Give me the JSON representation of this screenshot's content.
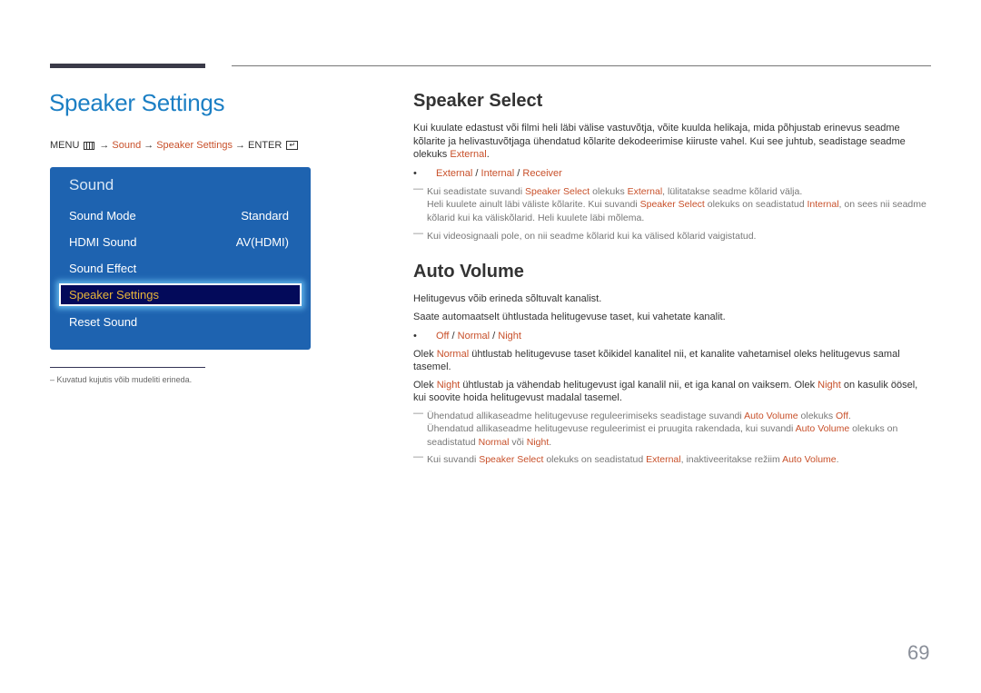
{
  "page_title": "Speaker Settings",
  "breadcrumb": {
    "menu": "MENU",
    "menu_icon": "menu-grid-icon",
    "arrow": "→",
    "sound": "Sound",
    "speaker_settings": "Speaker Settings",
    "enter": "ENTER",
    "enter_icon": "enter-icon"
  },
  "osd_menu": {
    "title": "Sound",
    "items": [
      {
        "label": "Sound Mode",
        "value": "Standard"
      },
      {
        "label": "HDMI Sound",
        "value": "AV(HDMI)"
      },
      {
        "label": "Sound Effect",
        "value": ""
      },
      {
        "label": "Speaker Settings",
        "value": "",
        "selected": true
      },
      {
        "label": "Reset Sound",
        "value": ""
      }
    ]
  },
  "left_note": "–  Kuvatud kujutis võib mudeliti erineda.",
  "speaker_select": {
    "heading": "Speaker Select",
    "intro": "Kui kuulate edastust või filmi heli läbi välise vastuvõtja, võite kuulda helikaja, mida põhjustab erinevus seadme kõlarite ja helivastuvõtjaga ühendatud kõlarite dekodeerimise kiiruste vahel. Kui see juhtub, seadistage seadme olekuks ",
    "intro_hl": "External",
    "intro_end": ".",
    "options": [
      "External",
      "Internal",
      "Receiver"
    ],
    "option_sep": " / ",
    "note1": {
      "a": "Kui seadistate suvandi ",
      "b": "Speaker Select",
      "c": " olekuks ",
      "d": "External",
      "e": ", lülitatakse seadme kõlarid välja.",
      "f": "Heli kuulete ainult läbi väliste kõlarite. Kui suvandi ",
      "g": "Speaker Select",
      "h": " olekuks on seadistatud ",
      "i": "Internal",
      "j": ", on sees nii seadme kõlarid kui ka väliskõlarid. Heli kuulete läbi mõlema."
    },
    "note2": "Kui videosignaali pole, on nii seadme kõlarid kui ka välised kõlarid vaigistatud."
  },
  "auto_volume": {
    "heading": "Auto Volume",
    "p1": "Helitugevus võib erineda sõltuvalt kanalist.",
    "p2": "Saate automaatselt ühtlustada helitugevuse taset, kui vahetate kanalit.",
    "options": [
      "Off",
      "Normal",
      "Night"
    ],
    "option_sep": " / ",
    "normal_desc": {
      "a": "Olek ",
      "b": "Normal",
      "c": " ühtlustab helitugevuse taset kõikidel kanalitel nii, et kanalite vahetamisel oleks helitugevus samal tasemel."
    },
    "night_desc": {
      "a": "Olek ",
      "b": "Night",
      "c": " ühtlustab ja vähendab helitugevust igal kanalil nii, et iga kanal on vaiksem. Olek ",
      "d": "Night",
      "e": " on kasulik öösel, kui soovite hoida helitugevust madalal tasemel."
    },
    "note1": {
      "a": "Ühendatud allikaseadme helitugevuse reguleerimiseks seadistage suvandi ",
      "b": "Auto Volume",
      "c": " olekuks ",
      "d": "Off",
      "e": ".",
      "f": "Ühendatud allikaseadme helitugevuse reguleerimist ei pruugita rakendada, kui suvandi ",
      "g": "Auto Volume",
      "h": " olekuks on seadistatud ",
      "i": "Normal",
      "j": " või ",
      "k": "Night",
      "l": "."
    },
    "note2": {
      "a": "Kui suvandi ",
      "b": "Speaker Select",
      "c": " olekuks on seadistatud ",
      "d": "External",
      "e": ", inaktiveeritakse režiim ",
      "f": "Auto Volume",
      "g": "."
    }
  },
  "note_dash": "—",
  "bullet_glyph": "•",
  "page_number": "69",
  "colors": {
    "title_blue": "#1c7fc4",
    "highlight": "#c8502a",
    "osd_bg": "#1e63b0",
    "osd_selected_bg": "#030a5a",
    "osd_selected_text": "#e8b53a"
  }
}
